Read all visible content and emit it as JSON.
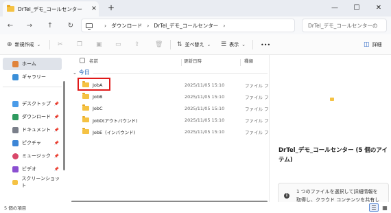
{
  "window": {
    "tab_title": "DrTel_デモ_コールセンター",
    "tab_close": "✕",
    "new_tab": "+",
    "minimize": "—",
    "maximize": "☐",
    "close": "✕"
  },
  "nav": {
    "back": "←",
    "forward": "→",
    "up": "↑",
    "refresh": "↻",
    "breadcrumbs": [
      "ダウンロード",
      "DrTel_デモ_コールセンター"
    ],
    "sep": "›",
    "search_placeholder": "DrTel_デモ_コールセンターの"
  },
  "toolbar": {
    "new_label": "新規作成",
    "sort_label": "並べ替え",
    "view_label": "表示",
    "more": "•••",
    "details_label": "詳細",
    "dropdown": "⌄",
    "icons": {
      "new": "⊕",
      "cut": "✂",
      "copy": "❐",
      "paste": "▣",
      "rename": "▭",
      "share": "⇪",
      "delete": "🗑",
      "sort": "⇅",
      "view": "☰",
      "details": "◫"
    }
  },
  "sidebar": {
    "items": [
      {
        "label": "ホーム",
        "icon": "home-icon",
        "color": "#e0833a"
      },
      {
        "label": "ギャラリー",
        "icon": "gallery-icon",
        "color": "#3a8fd8"
      },
      {
        "label": "デスクトップ",
        "icon": "desktop-icon",
        "color": "#4a9be8"
      },
      {
        "label": "ダウンロード",
        "icon": "download-icon",
        "color": "#2e9a5f"
      },
      {
        "label": "ドキュメント",
        "icon": "document-icon",
        "color": "#7a7f8a"
      },
      {
        "label": "ピクチャ",
        "icon": "picture-icon",
        "color": "#3d86d6"
      },
      {
        "label": "ミュージック",
        "icon": "music-icon",
        "color": "#d9486a"
      },
      {
        "label": "ビデオ",
        "icon": "video-icon",
        "color": "#8b4fd1"
      },
      {
        "label": "スクリーンショット",
        "icon": "folder-icon",
        "color": "#f5c243"
      }
    ],
    "pin": "📌"
  },
  "filelist": {
    "columns": {
      "name": "名前",
      "date": "更新日時",
      "type": "種類"
    },
    "group_label": "今日",
    "group_chev": "⌄",
    "rows": [
      {
        "name": "JobA",
        "date": "2025/11/05 15:10",
        "type": "ファイル フォル"
      },
      {
        "name": "JobB",
        "date": "2025/11/05 15:10",
        "type": "ファイル フォル"
      },
      {
        "name": "JobC",
        "date": "2025/11/05 15:10",
        "type": "ファイル フォル"
      },
      {
        "name": "JobD(アウトバウンド)",
        "date": "2025/11/05 15:10",
        "type": "ファイル フォル"
      },
      {
        "name": "JobE（インバウンド)",
        "date": "2025/11/05 15:10",
        "type": "ファイル フォル"
      }
    ]
  },
  "details": {
    "title": "DrTel_デモ_コールセンター (5 個のアイテム)",
    "info_icon": "i",
    "info_lines": [
      "1 つのファイルを選択して詳細情報を",
      "取得し、クラウド コンテンツを共有し"
    ]
  },
  "status": {
    "count": "5 個の項目",
    "view_list": "☰",
    "view_tiles": "▦"
  },
  "colors": {
    "highlight": "#e01919",
    "folder": "#f5c243",
    "group": "#1b5fb5"
  }
}
